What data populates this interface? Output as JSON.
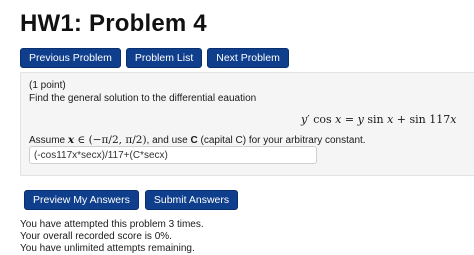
{
  "header": {
    "title": "HW1: Problem 4"
  },
  "nav": {
    "previous": "Previous Problem",
    "list": "Problem List",
    "next": "Next Problem"
  },
  "problem": {
    "points": "(1 point)",
    "question": "Find the general solution to the differential eauation",
    "equation": {
      "lhs_var": "y",
      "prime": "′",
      "cos1": "cos",
      "x1": "x",
      "eq": "=",
      "y2": "y",
      "sin1": "sin",
      "x2": "x",
      "plus": "+",
      "sin2": "sin",
      "coef": "117",
      "x3": "x"
    },
    "assume_prefix": "Assume",
    "assume_var": "x",
    "assume_in": "∈",
    "assume_interval": "(−π/2, π/2)",
    "assume_middle": ", and use",
    "assume_c": "C",
    "assume_suffix": "(capital C) for your arbitrary constant.",
    "answer_value": "(-cos117x*secx)/117+(C*secx)"
  },
  "actions": {
    "preview": "Preview My Answers",
    "submit": "Submit Answers"
  },
  "status": {
    "attempts": "You have attempted this problem 3 times.",
    "score": "Your overall recorded score is 0%.",
    "remaining": "You have unlimited attempts remaining."
  }
}
